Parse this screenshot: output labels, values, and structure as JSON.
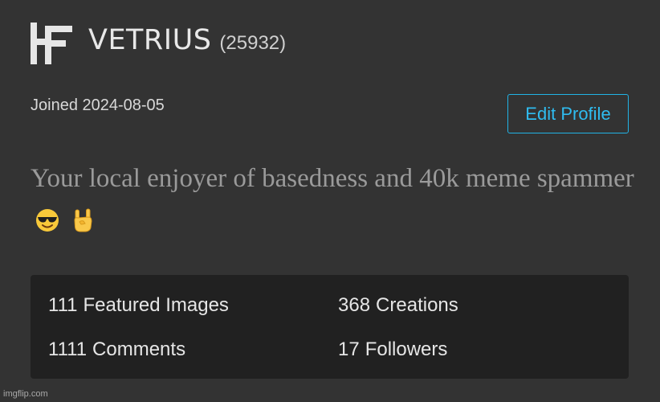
{
  "profile": {
    "username": "VETRIUS",
    "points": "(25932)",
    "joined": "Joined 2024-08-05",
    "bio_text": "Your local enjoyer of basedness and 40k meme spammer",
    "bio_emojis": [
      "smiling-face-with-sunglasses-icon",
      "sign-of-the-horns-icon"
    ]
  },
  "actions": {
    "edit_profile": "Edit Profile"
  },
  "stats": {
    "featured_images": {
      "count": "111",
      "label": "Featured Images"
    },
    "creations": {
      "count": "368",
      "label": "Creations"
    },
    "comments": {
      "count": "1111",
      "label": "Comments"
    },
    "followers": {
      "count": "17",
      "label": "Followers"
    }
  },
  "watermark": "imgflip.com",
  "colors": {
    "background": "#333333",
    "stats_panel": "#212121",
    "accent": "#2fbcf0",
    "bio_text": "#9a9a9a"
  }
}
